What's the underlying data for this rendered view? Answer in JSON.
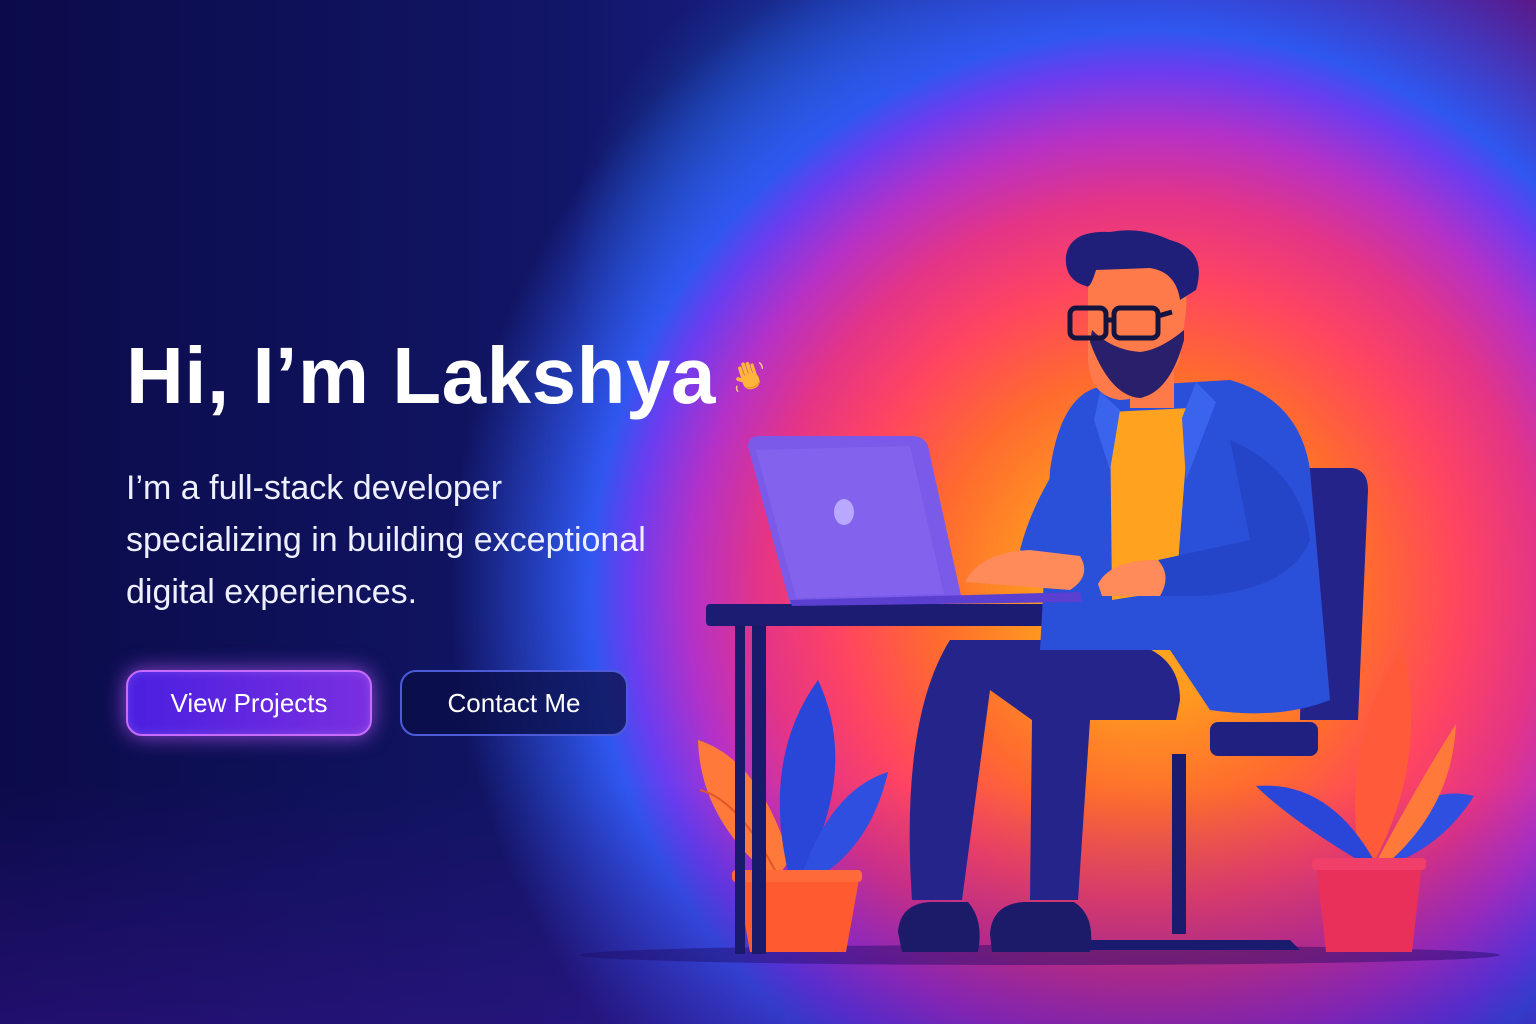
{
  "hero": {
    "headline": "Hi, I’m Lakshya",
    "wave_icon": "waving-hand-icon",
    "subtitle": "I’m a full-stack developer specializing in building exceptional digital experiences.",
    "primary_button_label": "View Projects",
    "secondary_button_label": "Contact Me"
  },
  "illustration": {
    "subject": "developer-at-laptop",
    "elements": [
      "developer-figure",
      "laptop",
      "desk",
      "chair",
      "left-plant",
      "right-plant"
    ]
  },
  "colors": {
    "background_dark": "#0b0b4a",
    "glow_center": "#ffb020",
    "glow_cyan": "#00c8e6",
    "primary_button": "#5a24e0",
    "primary_button_border": "#c86bff",
    "secondary_button_border": "#4d5bd8",
    "jacket": "#2a4fd8",
    "shirt": "#ffa21f",
    "laptop": "#7a5ae8"
  }
}
